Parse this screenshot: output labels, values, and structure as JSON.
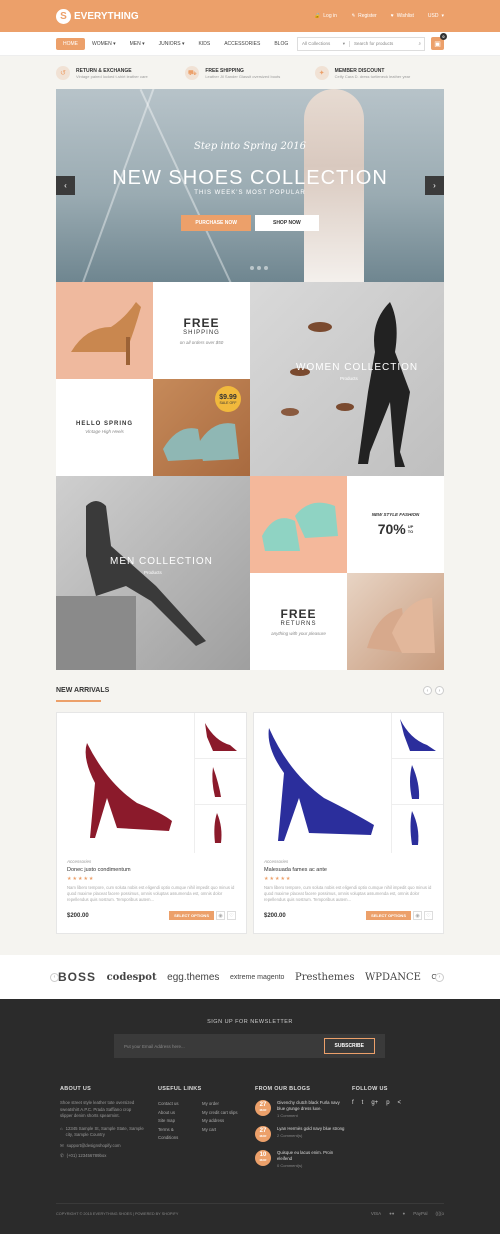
{
  "header": {
    "brand": "EVERYTHING",
    "logo_letter": "S",
    "links": [
      "Log in",
      "Register",
      "Wishlist"
    ],
    "currency": "USD"
  },
  "nav": {
    "items": [
      "HOME",
      "WOMEN",
      "MEN",
      "JUNIORS",
      "KIDS",
      "ACCESSORIES",
      "BLOG"
    ],
    "search_category": "All Collections",
    "search_placeholder": "Search for products",
    "cart_count": "0"
  },
  "features": [
    {
      "title": "RETURN & EXCHANGE",
      "sub": "Vintage paired locked t-shirt leather care"
    },
    {
      "title": "FREE SHIPPING",
      "sub": "Leather Jil Sander Glassit oversized boots"
    },
    {
      "title": "MEMBER DISCOUNT",
      "sub": "Celfy Cara D. dress turtleneck leather year"
    }
  ],
  "hero": {
    "subtitle": "Step into Spring 2016",
    "title": "NEW SHOES COLLECTION",
    "tagline": "THIS WEEK'S MOST POPULAR",
    "btn_purchase": "PURCHASE NOW",
    "btn_shop": "SHOP NOW"
  },
  "promos": {
    "free_shipping": {
      "big": "FREE",
      "mid": "SHIPPING",
      "small": "on all orders over $50"
    },
    "price_badge": {
      "price": "$9.99",
      "label": "SALE OFF"
    },
    "hello_spring": {
      "title": "HELLO SPRING",
      "sub": "Vintage High Heels"
    },
    "women": {
      "title": "WOMEN COLLECTION",
      "sub": "Products"
    },
    "men": {
      "title": "MEN COLLECTION",
      "sub": "Products"
    },
    "new_style": {
      "label": "NEW STYLE FASHION",
      "value": "70%",
      "up": "UP",
      "to": "TO"
    },
    "free_returns": {
      "big": "FREE",
      "mid": "RETURNS",
      "small": "anything with your pleasure"
    }
  },
  "arrivals": {
    "title": "NEW ARRIVALS",
    "products": [
      {
        "category": "Accessories",
        "name": "Donec justo condimentum",
        "stars": "★★★★★",
        "desc": "Nam libero tempore, cum soluta nobis est eligendi optio cumque nihil impedit quo minus id quod maxime placeat facere possimus, omnis voluptas assumenda est, omnis dolor repellendus quis nostrum. Temporibus autem...",
        "price": "$200.00",
        "button": "SELECT OPTIONS",
        "color": "#8b1a2b"
      },
      {
        "category": "Accessories",
        "name": "Malesuada fames ac ante",
        "stars": "★★★★★",
        "desc": "Nam libero tempore, cum soluta nobis est eligendi optio cumque nihil impedit quo minus id quod maxime placeat facere possimus, omnis voluptas assumenda est, omnis dolor repellendus quis nostrum. Temporibus autem...",
        "price": "$200.00",
        "button": "SELECT OPTIONS",
        "color": "#2b2e9c"
      }
    ]
  },
  "brands": [
    "BOSS",
    "codespot",
    "egg.themes",
    "extreme magento",
    "Presthemes",
    "WPDANCE",
    "ON"
  ],
  "footer": {
    "newsletter_title": "SIGN UP FOR NEWSLETTER",
    "newsletter_placeholder": "Put your Email Address here...",
    "newsletter_btn": "SUBSCRIBE",
    "about_title": "ABOUT US",
    "about_text": "Shoe street style leather tote oversized sweatshirt A.P.C. Prada Saffiano crop slipper denim shorts spearmint.",
    "address": "12345 Sample St, Sample State, Sample city, Sample Country",
    "email": "support@designshopify.com",
    "phone": "(+01) 123456789box",
    "links_title": "USEFUL LINKS",
    "links_col1": [
      "Contact us",
      "About us",
      "Site map",
      "Terms & Conditions"
    ],
    "links_col2": [
      "My order",
      "My credit cart slips",
      "My address",
      "My cart"
    ],
    "blogs_title": "FROM OUR BLOGS",
    "blogs": [
      {
        "day": "27",
        "month": "MAR",
        "title": "Givenchy clutch black Furla navy blue grunge dress luxe.",
        "comments": "1 Comment"
      },
      {
        "day": "27",
        "month": "MAR",
        "title": "Lyan Hermès gold navy blue strong",
        "comments": "2 Comment(s)"
      },
      {
        "day": "10",
        "month": "MAR",
        "title": "Quisque eu lacus enim. Proin eleifend",
        "comments": "0 Comment(s)"
      }
    ],
    "follow_title": "FOLLOW US",
    "social": [
      "f",
      "t",
      "g+",
      "p",
      "<"
    ],
    "copyright": "COPYRIGHT © 2015 EVERYTHING SHOES | POWERED BY SHOPIFY",
    "payments": [
      "VISA",
      "●●",
      "●",
      "PayPal",
      "((((o"
    ]
  }
}
